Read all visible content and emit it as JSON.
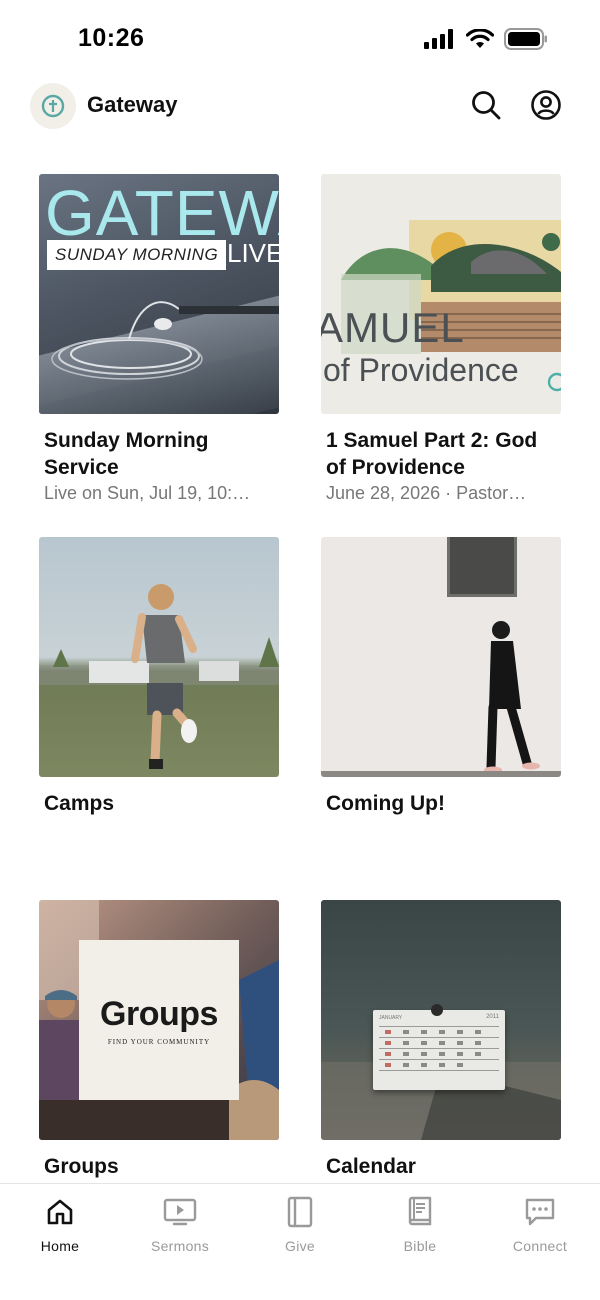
{
  "status_bar": {
    "time": "10:26",
    "icons": [
      "signal-icon",
      "wifi-icon",
      "battery-icon"
    ]
  },
  "header": {
    "title": "Gateway",
    "logo_icon": "gateway-logo-icon",
    "actions": [
      {
        "name": "search",
        "icon": "search-icon"
      },
      {
        "name": "profile",
        "icon": "profile-icon"
      }
    ]
  },
  "cards": [
    {
      "title": "Sunday Morning Service",
      "subtitle": "Live on Sun, Jul 19, 10:…",
      "thumb": {
        "big_word": "GATEWA",
        "tag": "SUNDAY MORNING",
        "live": "LIVE"
      }
    },
    {
      "title": "1 Samuel Part 2: God of Providence",
      "subtitle": "June 28, 2026 · Pastor…",
      "thumb": {
        "word": "AMUEL",
        "sub": "of Providence"
      }
    },
    {
      "title": "Camps",
      "subtitle": ""
    },
    {
      "title": "Coming Up!",
      "subtitle": ""
    },
    {
      "title": "Groups",
      "subtitle": "",
      "thumb": {
        "panel_title": "Groups",
        "panel_sub": "FIND YOUR COMMUNITY"
      }
    },
    {
      "title": "Calendar",
      "subtitle": "",
      "thumb": {
        "month": "JANUARY",
        "year": "2011"
      }
    }
  ],
  "tabbar": {
    "active": "Home",
    "tabs": [
      {
        "label": "Home",
        "icon": "home-icon"
      },
      {
        "label": "Sermons",
        "icon": "sermons-icon"
      },
      {
        "label": "Give",
        "icon": "give-icon"
      },
      {
        "label": "Bible",
        "icon": "bible-icon"
      },
      {
        "label": "Connect",
        "icon": "connect-icon"
      }
    ]
  },
  "colors": {
    "accent_text": "#111111",
    "muted_text": "#777777",
    "tab_inactive": "#9a9a9a",
    "logo_teal": "#5aa8a3"
  }
}
